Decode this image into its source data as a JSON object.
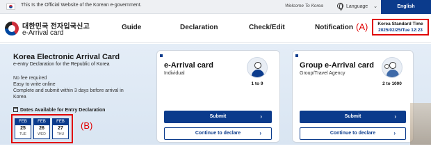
{
  "gov_bar": {
    "notice": "This Is the Official Website of the Korean e-government.",
    "welcome": "Welcome To Korea",
    "language_label": "Language",
    "english_label": "English"
  },
  "header": {
    "logo_korean": "대한민국 전자입국신고",
    "logo_english": "e-Arrival card",
    "nav": [
      "Guide",
      "Declaration",
      "Check/Edit",
      "Notification"
    ],
    "annotation_a": "(A)",
    "time_label": "Korea Standard Time",
    "time_value": "2025/02/25/Tue 12:23"
  },
  "hero": {
    "title": "Korea Electronic Arrival Card",
    "subtitle": "e-entry Declaration for the Republic of Korea",
    "features": [
      "No fee required",
      "Easy to write online",
      "Complete and submit within 3 days before arrival in",
      "Korea"
    ],
    "dates_title": "Dates Available for Entry Declaration",
    "dates": [
      {
        "month": "FEB",
        "day": "25",
        "weekday": "TUE"
      },
      {
        "month": "FEB",
        "day": "26",
        "weekday": "WED"
      },
      {
        "month": "FEB",
        "day": "27",
        "weekday": "THU"
      }
    ],
    "annotation_b": "(B)"
  },
  "cards": [
    {
      "title": "e-Arrival card",
      "subtitle": "Individual",
      "count": "1 to 9",
      "submit_label": "Submit",
      "continue_label": "Continue to declare",
      "icon": "person-icon"
    },
    {
      "title": "Group e-Arrival card",
      "subtitle": "Group/Travel Agency",
      "count": "2 to 1000",
      "submit_label": "Submit",
      "continue_label": "Continue to declare",
      "icon": "group-icon"
    }
  ],
  "colors": {
    "primary": "#0b3b8c",
    "annotation": "#e00000"
  }
}
